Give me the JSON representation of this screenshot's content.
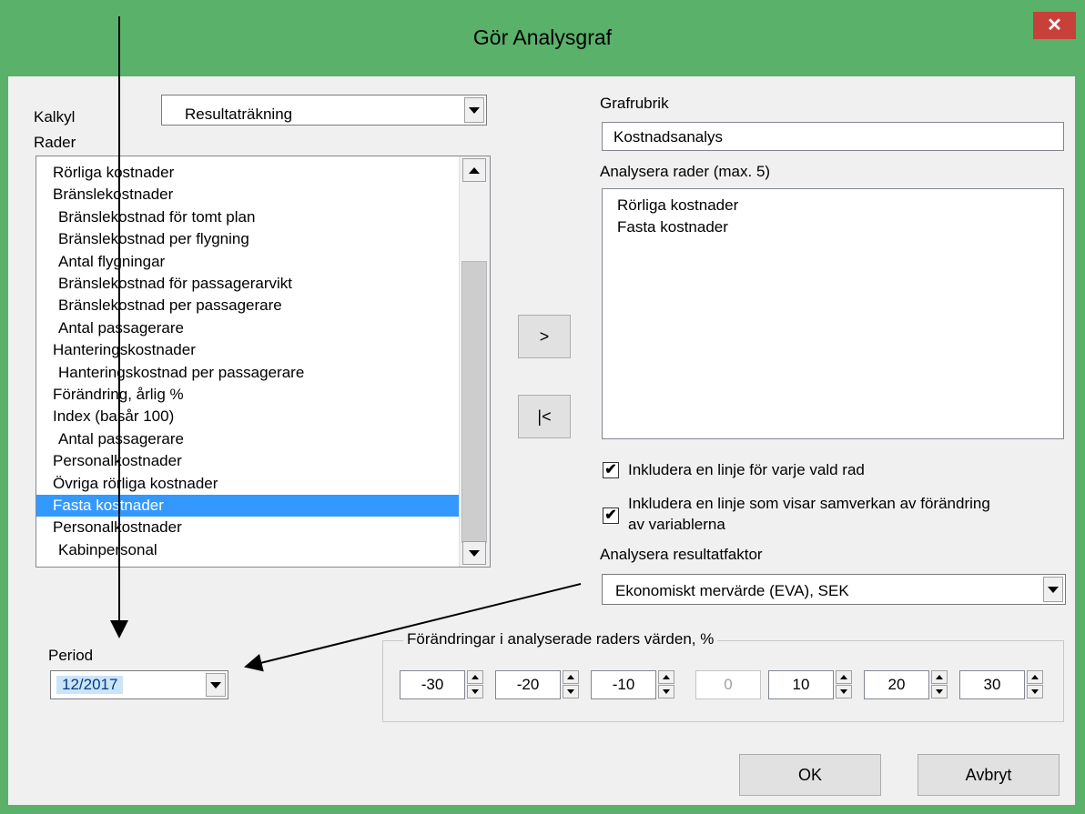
{
  "window": {
    "title": "Gör Analysgraf",
    "close_label": "✕"
  },
  "kalkyl": {
    "label": "Kalkyl",
    "value": "Resultaträkning"
  },
  "rader": {
    "label": "Rader",
    "items": [
      "Rörliga kostnader",
      "Bränslekostnader",
      " Bränslekostnad för tomt plan",
      " Bränslekostnad per flygning",
      " Antal flygningar",
      " Bränslekostnad för passagerarvikt",
      " Bränslekostnad per passagerare",
      " Antal passagerare",
      "Hanteringskostnader",
      " Hanteringskostnad per passagerare",
      "Förändring, årlig %",
      "Index (basår 100)",
      " Antal passagerare",
      "Personalkostnader",
      "Övriga rörliga kostnader",
      "Fasta kostnader",
      "Personalkostnader",
      " Kabinpersonal"
    ],
    "selected": "Fasta kostnader"
  },
  "buttons": {
    "add": ">",
    "remove": "|<",
    "ok": "OK",
    "cancel": "Avbryt"
  },
  "grafrubrik": {
    "label": "Grafrubrik",
    "value": "Kostnadsanalys"
  },
  "analysera_rader": {
    "label": "Analysera rader (max. 5)",
    "items": [
      "Rörliga kostnader",
      "Fasta kostnader"
    ]
  },
  "checkboxes": [
    {
      "label": "Inkludera en linje för varje vald rad",
      "checked": true
    },
    {
      "label_line1": "Inkludera en linje som visar samverkan av förändring",
      "label_line2": "av variablerna",
      "checked": true
    }
  ],
  "resultatfaktor": {
    "label": "Analysera resultatfaktor",
    "value": "Ekonomiskt mervärde (EVA), SEK"
  },
  "period": {
    "label": "Period",
    "value": "12/2017"
  },
  "changes": {
    "label": "Förändringar i analyserade raders värden, %",
    "values": [
      "-30",
      "-20",
      "-10",
      "0",
      "10",
      "20",
      "30"
    ],
    "disabled_index": 3
  },
  "colors": {
    "title_bar": "#59b16a",
    "selection": "#3399ff",
    "close": "#c7403a"
  }
}
